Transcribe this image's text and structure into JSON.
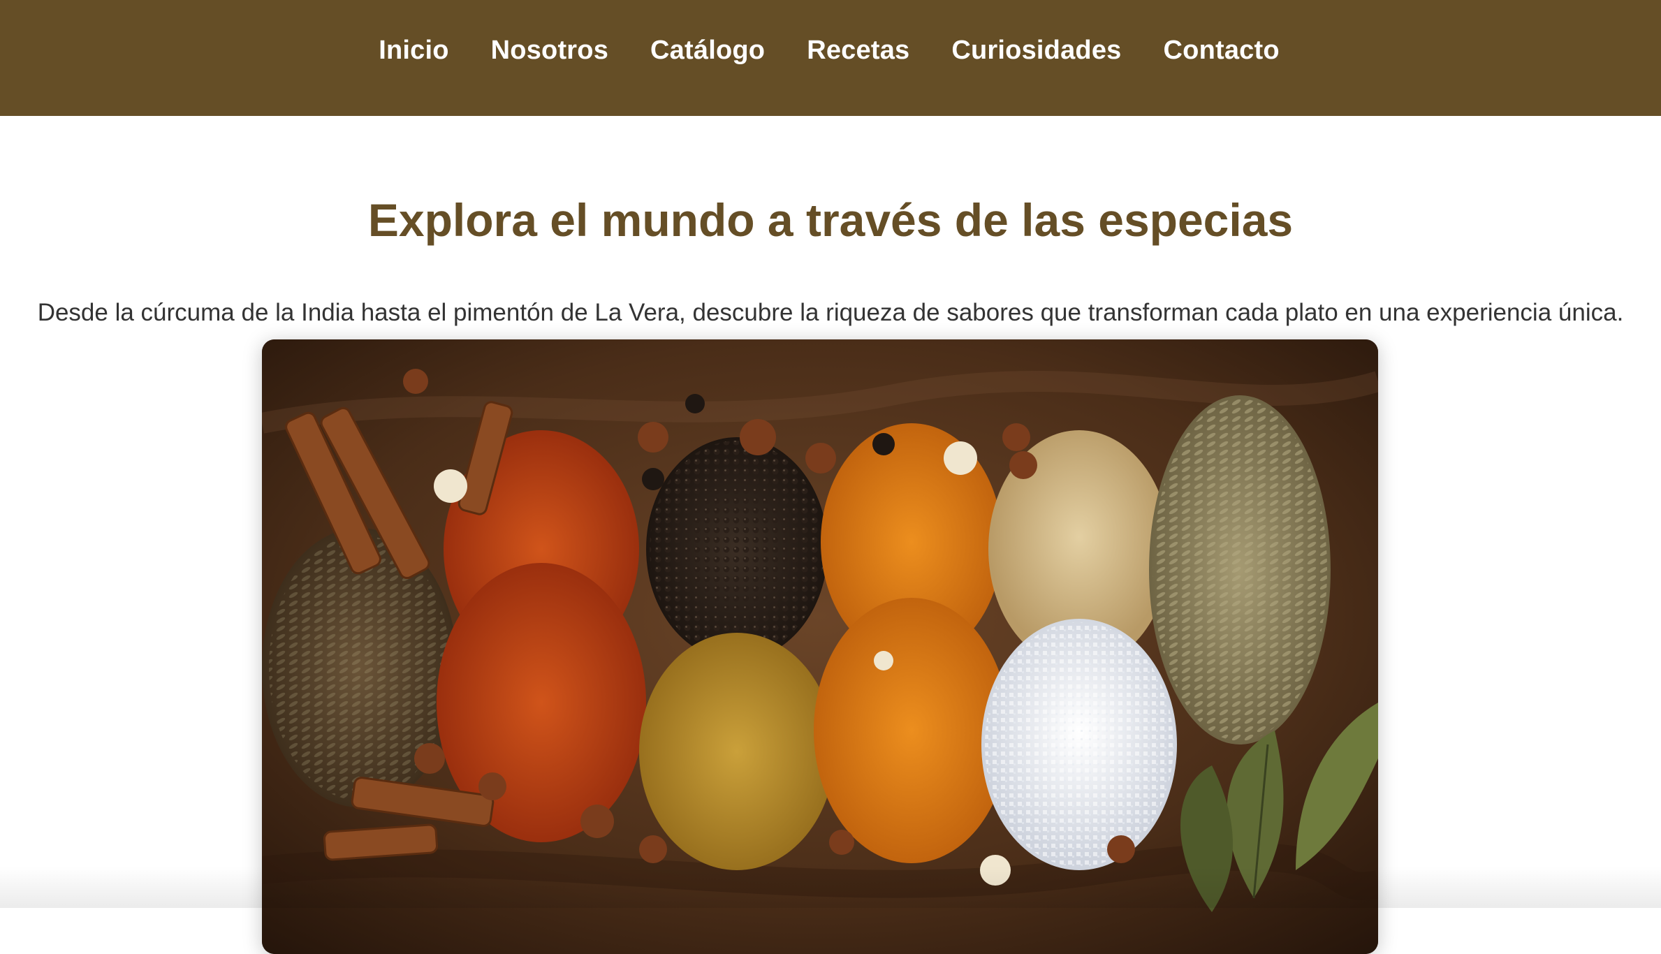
{
  "nav": {
    "items": [
      {
        "label": "Inicio"
      },
      {
        "label": "Nosotros"
      },
      {
        "label": "Catálogo"
      },
      {
        "label": "Recetas"
      },
      {
        "label": "Curiosidades"
      },
      {
        "label": "Contacto"
      }
    ]
  },
  "hero": {
    "title": "Explora el mundo a través de las especias",
    "text": "Desde la cúrcuma de la India hasta el pimentón de La Vera, descubre la riqueza de sabores que transforman cada plato en una experiencia única."
  },
  "image": {
    "subject": "spices-photo"
  },
  "colors": {
    "brand": "#654e26",
    "nav_text": "#ffffff",
    "body_text": "#333333"
  }
}
